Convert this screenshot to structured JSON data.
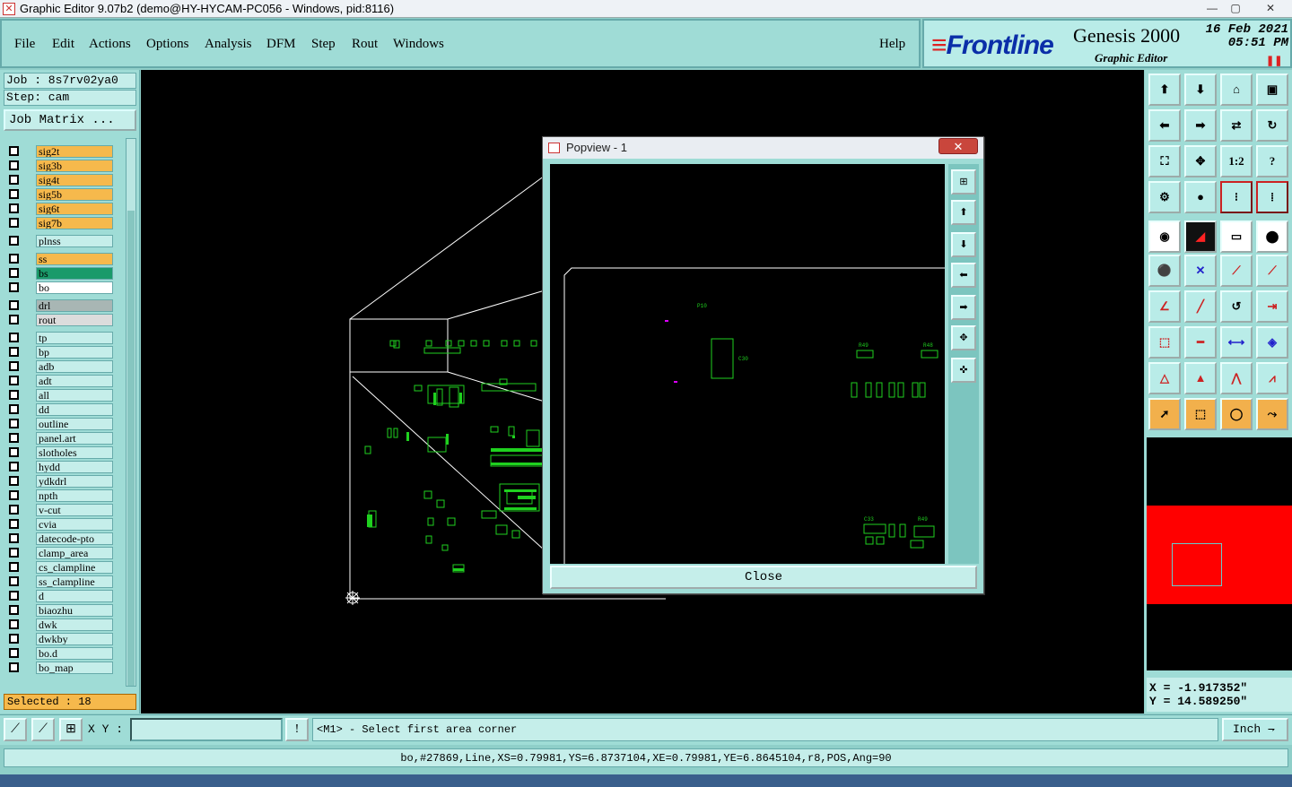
{
  "window": {
    "title": "Graphic Editor 9.07b2 (demo@HY-HYCAM-PC056 - Windows, pid:8116)",
    "min": "—",
    "max": "▢",
    "close": "✕"
  },
  "menu": {
    "items": [
      "File",
      "Edit",
      "Actions",
      "Options",
      "Analysis",
      "DFM",
      "Step",
      "Rout",
      "Windows"
    ],
    "help": "Help"
  },
  "brand": {
    "logo": "Frontline",
    "product": "Genesis 2000",
    "subtitle": "Graphic Editor",
    "date": "16 Feb 2021",
    "time": "05:51 PM"
  },
  "left": {
    "job": "Job : 8s7rv02ya0",
    "step": "Step: cam",
    "job_matrix": "Job Matrix ...",
    "selected": "Selected : 18",
    "layers": [
      {
        "name": "sig2t",
        "color": "#f6b94c"
      },
      {
        "name": "sig3b",
        "color": "#f6b94c"
      },
      {
        "name": "sig4t",
        "color": "#f6b94c"
      },
      {
        "name": "sig5b",
        "color": "#f6b94c"
      },
      {
        "name": "sig6t",
        "color": "#f6b94c"
      },
      {
        "name": "sig7b",
        "color": "#f6b94c"
      },
      {
        "name": "plnss",
        "color": "#c5eeea"
      },
      {
        "name": "ss",
        "color": "#f6b94c"
      },
      {
        "name": "bs",
        "color": "#1a9a6a"
      },
      {
        "name": "bo",
        "color": "#ffffff"
      },
      {
        "name": "drl",
        "color": "#a8b6b4"
      },
      {
        "name": "rout",
        "color": "#dcdcdc"
      },
      {
        "name": "tp",
        "color": "#c5eeea"
      },
      {
        "name": "bp",
        "color": "#c5eeea"
      },
      {
        "name": "adb",
        "color": "#c5eeea"
      },
      {
        "name": "adt",
        "color": "#c5eeea"
      },
      {
        "name": "all",
        "color": "#c5eeea"
      },
      {
        "name": "dd",
        "color": "#c5eeea"
      },
      {
        "name": "outline",
        "color": "#c5eeea"
      },
      {
        "name": "panel.art",
        "color": "#c5eeea"
      },
      {
        "name": "slotholes",
        "color": "#c5eeea"
      },
      {
        "name": "hydd",
        "color": "#c5eeea"
      },
      {
        "name": "ydkdrl",
        "color": "#c5eeea"
      },
      {
        "name": "npth",
        "color": "#c5eeea"
      },
      {
        "name": "v-cut",
        "color": "#c5eeea"
      },
      {
        "name": "cvia",
        "color": "#c5eeea"
      },
      {
        "name": "datecode-pto",
        "color": "#c5eeea"
      },
      {
        "name": "clamp_area",
        "color": "#c5eeea"
      },
      {
        "name": "cs_clampline",
        "color": "#c5eeea"
      },
      {
        "name": "ss_clampline",
        "color": "#c5eeea"
      },
      {
        "name": "d",
        "color": "#c5eeea"
      },
      {
        "name": "biaozhu",
        "color": "#c5eeea"
      },
      {
        "name": "dwk",
        "color": "#c5eeea"
      },
      {
        "name": "dwkby",
        "color": "#c5eeea"
      },
      {
        "name": "bo.d",
        "color": "#c5eeea"
      },
      {
        "name": "bo_map",
        "color": "#c5eeea"
      }
    ]
  },
  "right": {
    "tool_labels": [
      "1:2",
      "?"
    ],
    "x": "X = -1.917352\"",
    "y": "Y = 14.589250\""
  },
  "popview": {
    "title": "Popview - 1",
    "close_x": "✕",
    "close": "Close"
  },
  "bottom": {
    "xy_label": "X Y :",
    "prompt": "<M1> - Select first area corner",
    "unit": "Inch",
    "status": "bo,#27869,Line,XS=0.79981,YS=6.8737104,XE=0.79981,YE=6.8645104,r8,POS,Ang=90"
  },
  "colors": {
    "accent": "#9fdcd6",
    "highlight": "#f6b94c",
    "trace": "#1fd11f"
  }
}
